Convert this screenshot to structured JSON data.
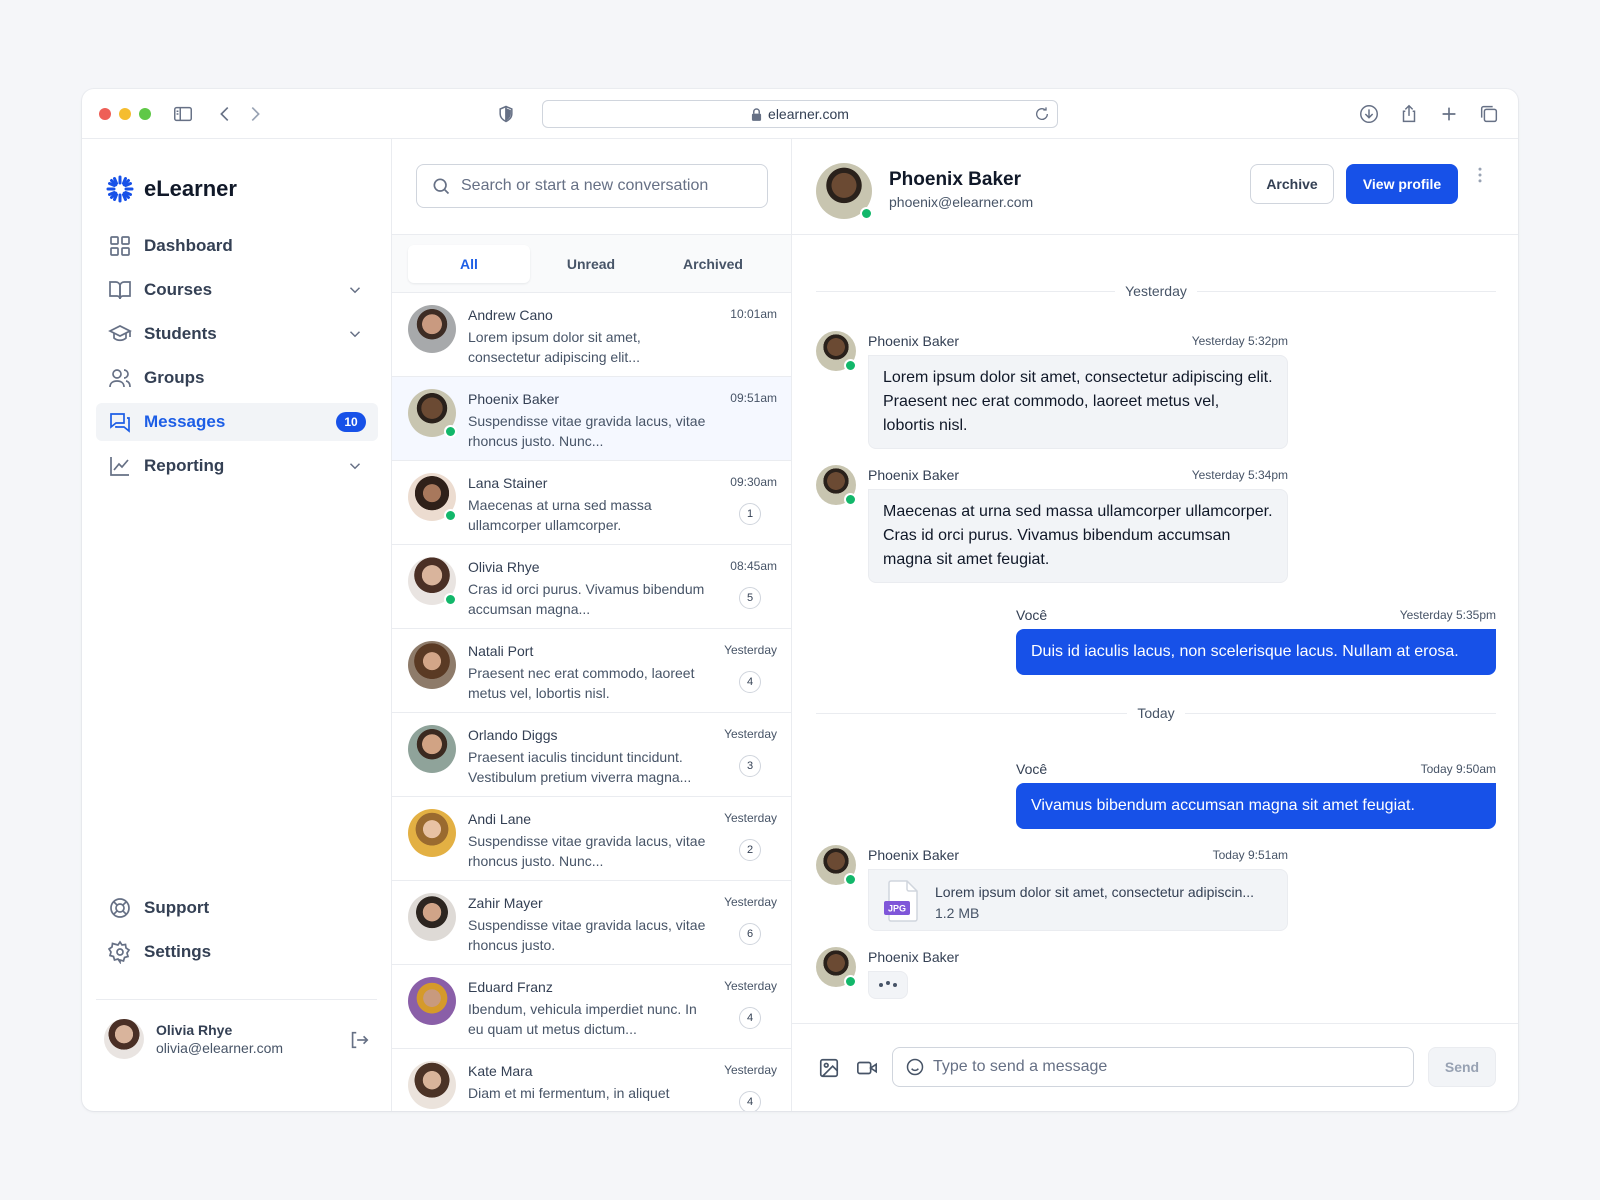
{
  "browser": {
    "url": "elearner.com"
  },
  "app": {
    "name": "eLearner"
  },
  "colors": {
    "accent": "#1751e8",
    "online": "#12b76a"
  },
  "sidebar": {
    "items": [
      {
        "label": "Dashboard",
        "icon": "grid-icon"
      },
      {
        "label": "Courses",
        "icon": "book-icon"
      },
      {
        "label": "Students",
        "icon": "graduation-cap-icon"
      },
      {
        "label": "Groups",
        "icon": "users-icon"
      },
      {
        "label": "Messages",
        "icon": "messages-icon",
        "badge": "10"
      },
      {
        "label": "Reporting",
        "icon": "line-chart-icon"
      }
    ],
    "bottom": [
      {
        "label": "Support",
        "icon": "life-buoy-icon"
      },
      {
        "label": "Settings",
        "icon": "settings-icon"
      }
    ],
    "user": {
      "name": "Olivia Rhye",
      "email": "olivia@elearner.com"
    }
  },
  "list": {
    "search_placeholder": "Search or start a new conversation",
    "tabs": [
      "All",
      "Unread",
      "Archived"
    ],
    "conversations": [
      {
        "name": "Andrew Cano",
        "preview": "Lorem ipsum dolor sit amet, consectetur adipiscing elit...",
        "time": "10:01am",
        "unread": ""
      },
      {
        "name": "Phoenix Baker",
        "preview": "Suspendisse vitae gravida lacus, vitae rhoncus justo. Nunc...",
        "time": "09:51am",
        "unread": ""
      },
      {
        "name": "Lana Stainer",
        "preview": "Maecenas at urna sed massa ullamcorper ullamcorper.",
        "time": "09:30am",
        "unread": "1"
      },
      {
        "name": "Olivia Rhye",
        "preview": " Cras id orci purus. Vivamus bibendum accumsan magna...",
        "time": "08:45am",
        "unread": "5"
      },
      {
        "name": "Natali Port",
        "preview": "Praesent nec erat commodo, laoreet metus vel, lobortis nisl.",
        "time": "Yesterday",
        "unread": "4"
      },
      {
        "name": "Orlando Diggs",
        "preview": "Praesent iaculis tincidunt tincidunt. Vestibulum pretium viverra magna...",
        "time": "Yesterday",
        "unread": "3"
      },
      {
        "name": "Andi Lane",
        "preview": "Suspendisse vitae gravida lacus, vitae rhoncus justo. Nunc...",
        "time": "Yesterday",
        "unread": "2"
      },
      {
        "name": "Zahir Mayer",
        "preview": "Suspendisse vitae gravida lacus, vitae rhoncus justo.",
        "time": "Yesterday",
        "unread": "6"
      },
      {
        "name": "Eduard Franz",
        "preview": "Ibendum, vehicula imperdiet nunc. In eu quam ut metus dictum...",
        "time": "Yesterday",
        "unread": "4"
      },
      {
        "name": "Kate Mara",
        "preview": "Diam et mi fermentum, in aliquet",
        "time": "Yesterday",
        "unread": "4"
      }
    ]
  },
  "chat": {
    "contact": {
      "name": "Phoenix Baker",
      "email": "phoenix@elearner.com"
    },
    "archive_label": "Archive",
    "view_profile_label": "View profile",
    "day_yesterday": "Yesterday",
    "day_today": "Today",
    "messages": [
      {
        "sender": "Phoenix Baker",
        "time": "Yesterday 5:32pm",
        "text": "Lorem ipsum dolor sit amet, consectetur adipiscing elit. Praesent nec erat commodo, laoreet metus vel, lobortis nisl."
      },
      {
        "sender": "Phoenix Baker",
        "time": "Yesterday 5:34pm",
        "text": "Maecenas at urna sed massa ullamcorper ullamcorper. Cras id orci purus. Vivamus bibendum accumsan magna sit amet feugiat."
      },
      {
        "sender": "Você",
        "time": "Yesterday 5:35pm",
        "text": "Duis id iaculis lacus, non scelerisque lacus. Nullam at erosa."
      },
      {
        "sender": "Você",
        "time": "Today 9:50am",
        "text": "Vivamus bibendum accumsan magna sit amet feugiat."
      },
      {
        "sender": "Phoenix Baker",
        "time": "Today 9:51am",
        "file_name": "Lorem ipsum dolor sit amet, consectetur adipiscin...",
        "file_size": "1.2 MB",
        "file_type": "JPG"
      },
      {
        "sender": "Phoenix Baker"
      }
    ],
    "composer_placeholder": "Type to send a message",
    "send_label": "Send"
  }
}
